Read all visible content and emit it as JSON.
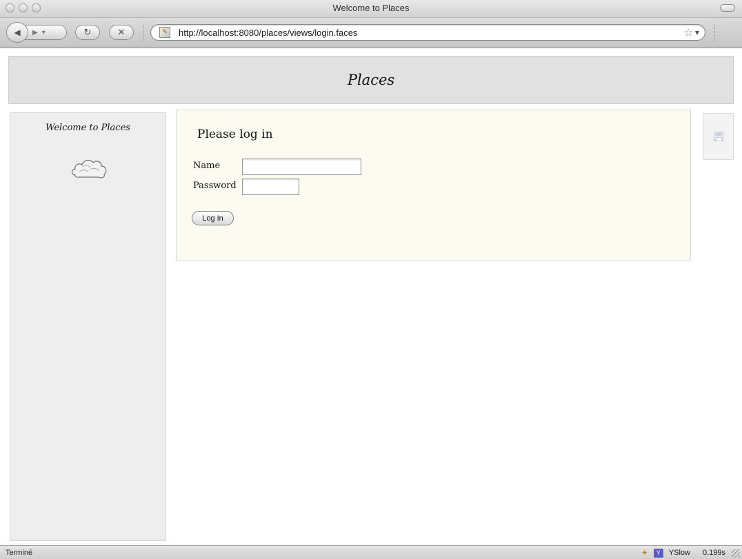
{
  "window": {
    "title": "Welcome to Places"
  },
  "toolbar": {
    "back_icon": "back-arrow-icon",
    "forward_icon": "forward-arrow-icon",
    "reload_icon": "reload-icon",
    "stop_icon": "stop-icon",
    "url": "http://localhost:8080/places/views/login.faces",
    "bookmark_icon": "star-icon"
  },
  "header": {
    "title": "Places"
  },
  "sidebar": {
    "title": "Welcome to Places",
    "logo_icon": "cloud-icon"
  },
  "login": {
    "heading": "Please log in",
    "name_label": "Name",
    "name_value": "",
    "password_label": "Password",
    "password_value": "",
    "submit_label": "Log In"
  },
  "side_tab": {
    "icon": "disk-icon"
  },
  "status": {
    "text": "Terminé",
    "yslow_label": "YSlow",
    "load_time": "0.199s"
  },
  "colors": {
    "header_bg": "#e1e1e1",
    "sidebar_bg": "#eeeeee",
    "login_panel_bg": "#fbfbf1"
  }
}
